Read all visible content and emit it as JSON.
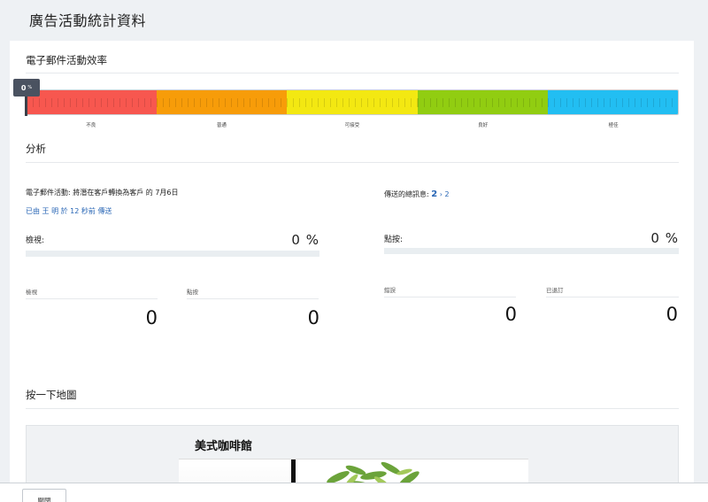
{
  "page": {
    "title": "廣告活動統計資料"
  },
  "efficiency": {
    "title": "電子郵件活動效率",
    "value": 0,
    "marker_value": "0",
    "marker_unit": "%",
    "levels": [
      "不良",
      "普通",
      "可接受",
      "良好",
      "極佳"
    ],
    "colors": [
      "#f7574f",
      "#f79c09",
      "#f3e812",
      "#91cd11",
      "#22bef2"
    ]
  },
  "analysis": {
    "title": "分析",
    "campaign_line": "電子郵件活動: 將潛在客戶轉換為客戶 的 7月6日",
    "sent_prefix": "已由",
    "sender": "王 明",
    "sent_suffix": "於 12 秒前 傳送",
    "total_label": "傳送的總訊息:",
    "total_value": "2",
    "total_sep": "›",
    "total_link": "2",
    "views_label": "檢視:",
    "views_pct": "0 %",
    "views_fraction": 0,
    "clicks_label": "點按:",
    "clicks_pct": "0 %",
    "clicks_fraction": 0,
    "stats": [
      {
        "label": "檢視",
        "value": "0"
      },
      {
        "label": "點按",
        "value": "0"
      },
      {
        "label": "錯誤",
        "value": "0"
      },
      {
        "label": "已退訂",
        "value": "0"
      }
    ]
  },
  "map": {
    "title": "按一下地圖",
    "shop_name": "美式咖啡館"
  },
  "footer": {
    "close_label": "關閉"
  }
}
